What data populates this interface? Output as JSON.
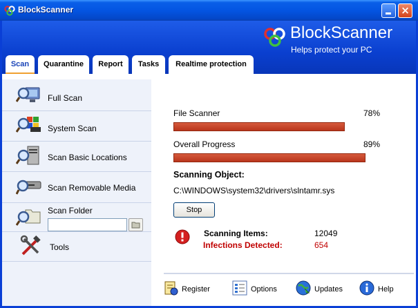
{
  "window": {
    "title": "BlockScanner",
    "minimize_label": "minimize",
    "close_label": "×"
  },
  "header": {
    "brand_name": "BlockScanner",
    "tagline": "Helps protect your PC"
  },
  "tabs": [
    {
      "label": "Scan",
      "active": true
    },
    {
      "label": "Quarantine",
      "active": false
    },
    {
      "label": "Report",
      "active": false
    },
    {
      "label": "Tasks",
      "active": false
    },
    {
      "label": "Realtime protection",
      "active": false
    }
  ],
  "sidebar": {
    "items": [
      {
        "label": "Full Scan",
        "icon": "magnifier-monitor-icon"
      },
      {
        "label": "System Scan",
        "icon": "magnifier-windows-icon"
      },
      {
        "label": "Scan Basic Locations",
        "icon": "magnifier-computer-icon"
      },
      {
        "label": "Scan Removable Media",
        "icon": "magnifier-drive-icon"
      },
      {
        "label": "Scan Folder",
        "icon": "magnifier-folder-icon"
      },
      {
        "label": "Tools",
        "icon": "tools-icon"
      }
    ],
    "folder_input_value": ""
  },
  "scan": {
    "file_scanner_label": "File Scanner",
    "file_scanner_percent_text": "78%",
    "file_scanner_progress": 0.78,
    "overall_label": "Overall Progress",
    "overall_percent_text": "89%",
    "overall_progress": 0.89,
    "scanning_object_label": "Scanning Object:",
    "scanning_object_path": "C:\\WINDOWS\\system32\\drivers\\slntamr.sys",
    "stop_label": "Stop",
    "items_label": "Scanning Items:",
    "items_value": "12049",
    "infections_label": "Infections Detected:",
    "infections_value": "654"
  },
  "footer": {
    "register_label": "Register",
    "options_label": "Options",
    "updates_label": "Updates",
    "help_label": "Help"
  },
  "colors": {
    "title_bar": "#0455e2",
    "accent_blue": "#0a3fcf",
    "progress_fill": "#c0401f",
    "alert_red": "#c00000",
    "sidebar_bg": "#eef2fa"
  }
}
